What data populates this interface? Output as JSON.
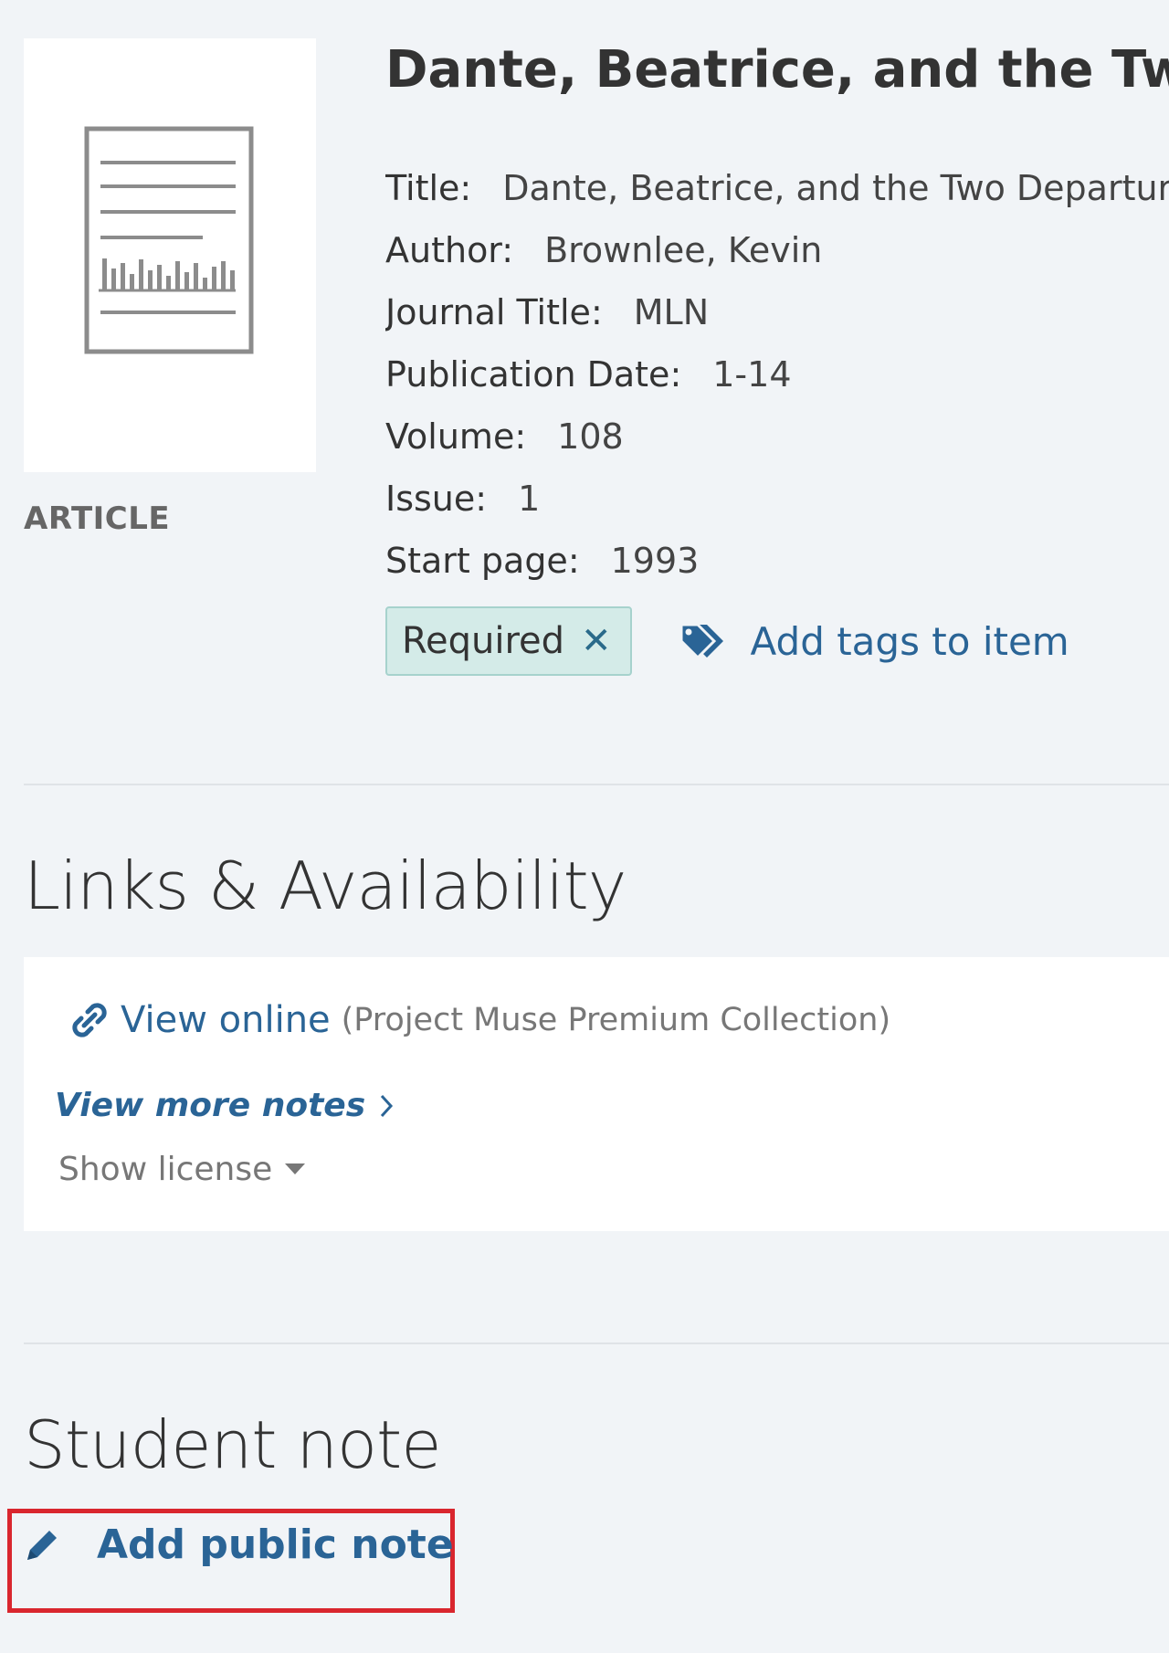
{
  "record": {
    "type_label": "ARTICLE",
    "title": "Dante, Beatrice, and the Two Departures",
    "fields": [
      {
        "label": "Title:",
        "value": "Dante, Beatrice, and the Two Departures"
      },
      {
        "label": "Author:",
        "value": "Brownlee, Kevin"
      },
      {
        "label": "Journal Title:",
        "value": "MLN"
      },
      {
        "label": "Publication Date:",
        "value": "1-14"
      },
      {
        "label": "Volume:",
        "value": "108"
      },
      {
        "label": "Issue:",
        "value": "1"
      },
      {
        "label": "Start page:",
        "value": "1993"
      }
    ],
    "tag": {
      "label": "Required",
      "remove_glyph": "✕"
    },
    "add_tags_label": "Add tags to item"
  },
  "links": {
    "heading": "Links & Availability",
    "view_online_label": "View online",
    "collection": "(Project Muse Premium Collection)",
    "view_more_notes": "View more notes",
    "show_license": "Show license"
  },
  "student_note": {
    "heading": "Student note",
    "add_note_label": "Add public note"
  },
  "icons": {
    "document": "document-icon",
    "tag": "tag-icon",
    "link": "link-icon",
    "chevron": "chevron-right-icon",
    "caret": "caret-down-icon",
    "pencil": "pencil-icon"
  },
  "colors": {
    "link": "#2a6496",
    "tag_bg": "#d4ebe8",
    "highlight": "#d9262e"
  }
}
